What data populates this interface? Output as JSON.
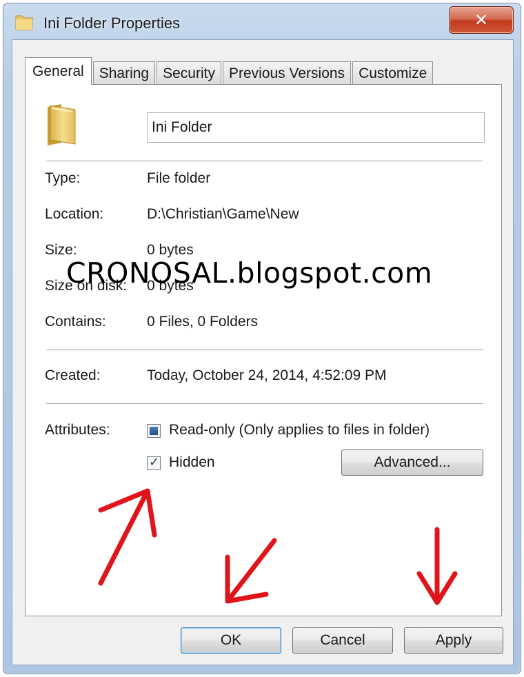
{
  "window": {
    "title": "Ini Folder Properties",
    "close_glyph": "✕"
  },
  "tabs": [
    {
      "label": "General",
      "active": true
    },
    {
      "label": "Sharing",
      "active": false
    },
    {
      "label": "Security",
      "active": false
    },
    {
      "label": "Previous Versions",
      "active": false
    },
    {
      "label": "Customize",
      "active": false
    }
  ],
  "general": {
    "folder_icon": "folder-icon",
    "name": "Ini Folder",
    "rows": [
      {
        "label": "Type:",
        "value": "File folder"
      },
      {
        "label": "Location:",
        "value": "D:\\Christian\\Game\\New"
      },
      {
        "label": "Size:",
        "value": "0 bytes"
      },
      {
        "label": "Size on disk:",
        "value": "0 bytes"
      },
      {
        "label": "Contains:",
        "value": "0 Files, 0 Folders"
      }
    ],
    "created": {
      "label": "Created:",
      "value": "Today, October 24, 2014, 4:52:09 PM"
    },
    "attributes": {
      "label": "Attributes:",
      "readonly": {
        "label": "Read-only (Only applies to files in folder)",
        "state": "indeterminate"
      },
      "hidden": {
        "label": "Hidden",
        "state": "checked"
      },
      "advanced_label": "Advanced..."
    }
  },
  "buttons": {
    "ok": "OK",
    "cancel": "Cancel",
    "apply": "Apply"
  },
  "overlay": {
    "watermark": "CRONOSAL.blogspot.com",
    "arrow_color": "#e0141b"
  }
}
